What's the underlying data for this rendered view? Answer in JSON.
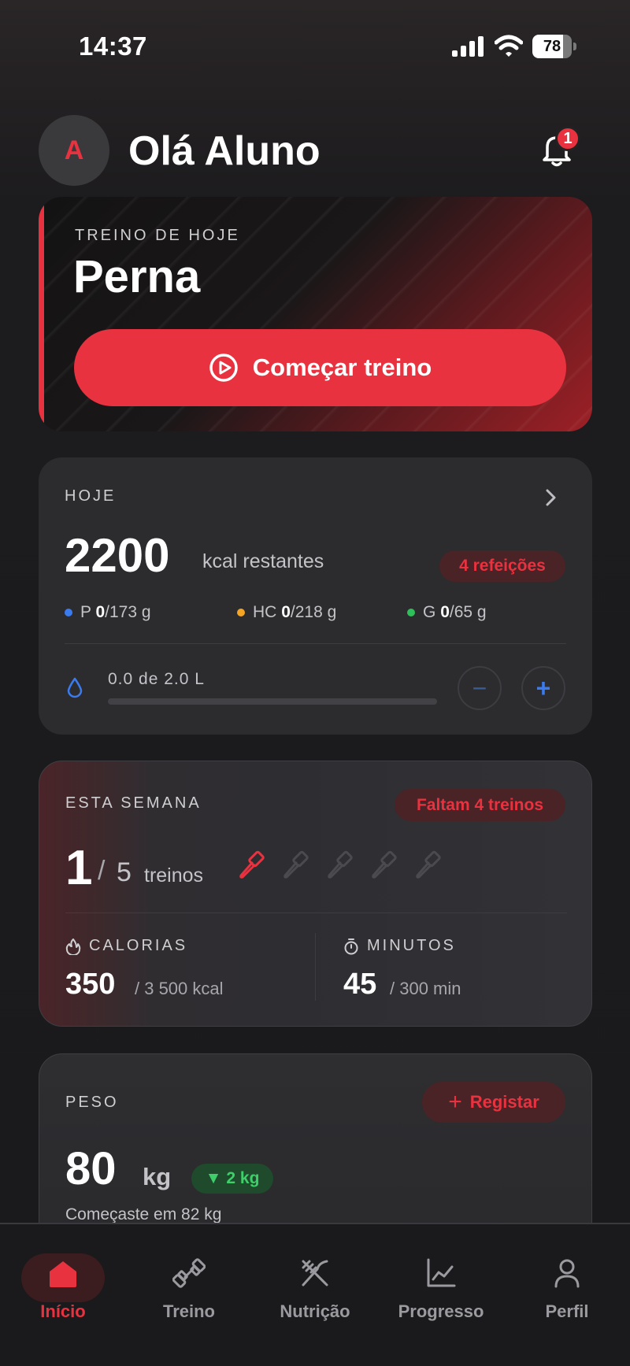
{
  "status_bar": {
    "time": "14:37",
    "battery": "78",
    "battery_level": 0.78
  },
  "header": {
    "avatar_initial": "A",
    "greeting": "Olá Aluno",
    "notification_count": "1"
  },
  "workout_card": {
    "label": "TREINO DE HOJE",
    "title": "Perna",
    "start_button": "Começar treino"
  },
  "today": {
    "label": "HOJE",
    "kcal_value": "2200",
    "kcal_unit": "kcal restantes",
    "meals_pill": "4 refeições",
    "macros": [
      {
        "letter": "P",
        "value": "0",
        "goal": "/173 g",
        "color": "#3b7bf0"
      },
      {
        "letter": "HC",
        "value": "0",
        "goal": "/218 g",
        "color": "#f5a524"
      },
      {
        "letter": "G",
        "value": "0",
        "goal": "/65 g",
        "color": "#2fbf5a"
      }
    ],
    "water_text": "0.0 de 2.0 L",
    "water_progress": 0.0,
    "minus": "−",
    "plus": "+"
  },
  "week": {
    "label": "ESTA SEMANA",
    "badge": "Faltam 4 treinos",
    "done": "1",
    "slash": "/",
    "total": "5",
    "unit": "treinos",
    "completed_count": 1,
    "goal_count": 5,
    "calories_label": "CALORIAS",
    "calories_value": "350",
    "calories_goal": "/ 3 500 kcal",
    "minutes_label": "MINUTOS",
    "minutes_value": "45",
    "minutes_goal": "/ 300 min"
  },
  "weight": {
    "label": "PESO",
    "register_button": "Registar",
    "value": "80",
    "unit": "kg",
    "change": "2 kg",
    "start_text": "Começaste em 82 kg"
  },
  "tabs": [
    {
      "label": "Início",
      "icon": "home-icon",
      "active": true
    },
    {
      "label": "Treino",
      "icon": "dumbbell-icon",
      "active": false
    },
    {
      "label": "Nutrição",
      "icon": "fork-knife-icon",
      "active": false
    },
    {
      "label": "Progresso",
      "icon": "chart-icon",
      "active": false
    },
    {
      "label": "Perfil",
      "icon": "user-icon",
      "active": false
    }
  ],
  "colors": {
    "accent": "#e8323f",
    "background": "#1c1b1d",
    "card": "#2c2c2f",
    "water": "#3b7bf0",
    "success": "#3ecf6a"
  }
}
